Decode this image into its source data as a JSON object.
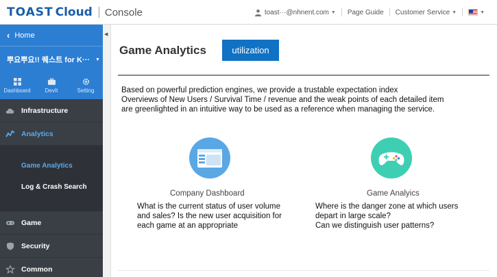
{
  "header": {
    "logo_brand": "TOAST",
    "logo_product": "Cloud",
    "console": "Console",
    "user": "toast···@nhnent.com",
    "page_guide": "Page Guide",
    "customer_service": "Customer Service"
  },
  "sidebar": {
    "home": "Home",
    "project": "뿌요뿌요!! 퀘스트 for K···",
    "tools": [
      "Dashboard",
      "DevIt",
      "Setting"
    ],
    "nav": [
      {
        "label": "Infrastructure",
        "icon": "cloud-icon"
      },
      {
        "label": "Analytics",
        "icon": "analytics-icon"
      }
    ],
    "sub": [
      "Game Analytics",
      "Log & Crash Search"
    ],
    "nav_bottom": [
      {
        "label": "Game",
        "icon": "gamepad-icon"
      },
      {
        "label": "Security",
        "icon": "shield-icon"
      },
      {
        "label": "Common",
        "icon": "star-icon"
      }
    ]
  },
  "main": {
    "title": "Game Analytics",
    "badge": "utilization",
    "intro_lines": [
      "Based on powerful prediction engines, we provide a trustable expectation index",
      "Overviews of New Users / Survival Time / revenue and the weak points of each detailed item",
      "are greenlighted in an intuitive way to be used as a reference when managing the service."
    ],
    "features": [
      {
        "title": "Company Dashboard",
        "lines": [
          "What is the current status of user volume",
          "and sales? Is the new user acquisition for",
          "each game at an appropriate"
        ]
      },
      {
        "title": "Game Analyics",
        "lines": [
          "Where is the danger zone at which users",
          "depart in large scale?",
          "Can we distinguish  user patterns?"
        ]
      }
    ]
  },
  "colors": {
    "brand_blue": "#1a5eab",
    "sidebar_accent": "#2c7ed3",
    "badge_blue": "#0f72c4",
    "dashboard_circle": "#5aa7e6",
    "game_circle": "#3ecfb3",
    "active_text": "#5aaaf0"
  }
}
